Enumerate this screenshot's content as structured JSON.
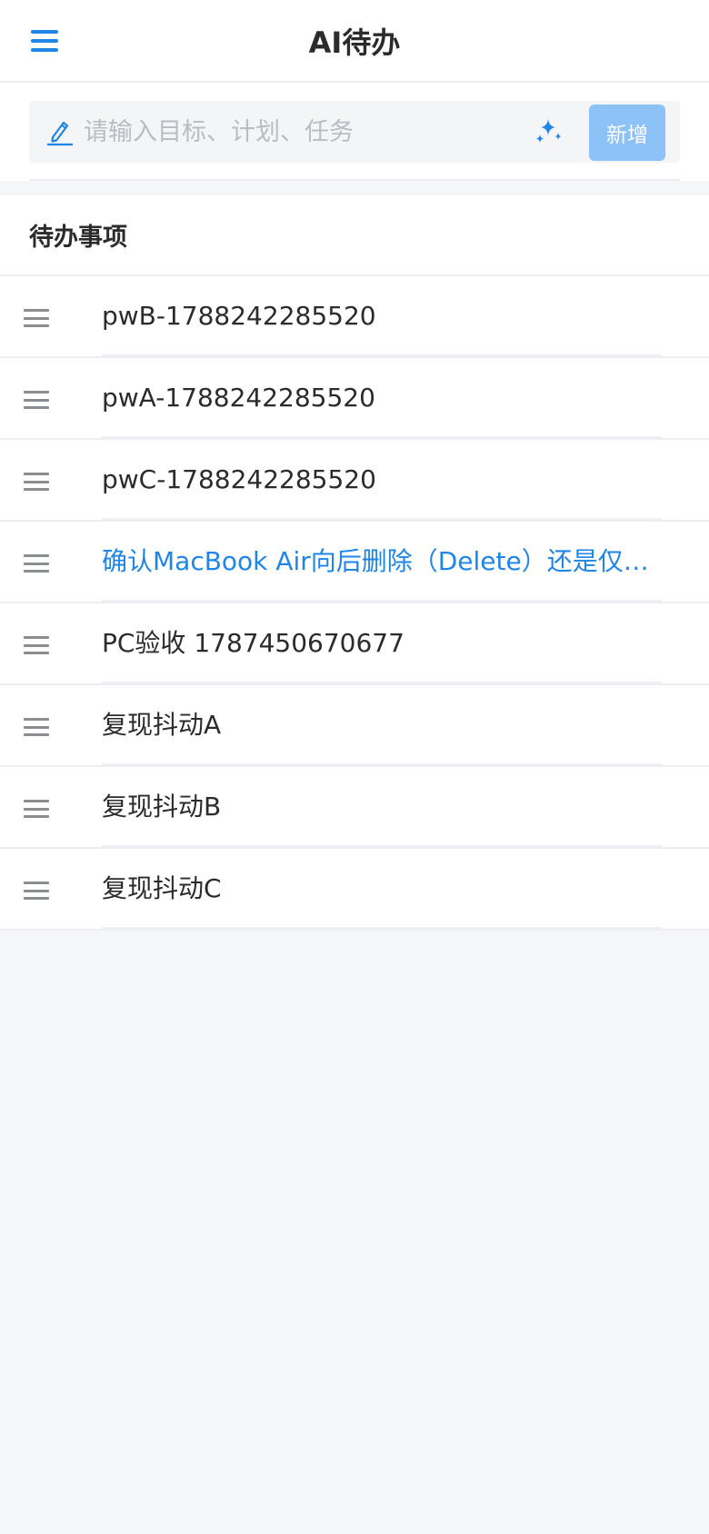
{
  "header": {
    "title": "AI待办"
  },
  "input": {
    "placeholder": "请输入目标、计划、任务",
    "value": "",
    "add_label": "新增"
  },
  "colors": {
    "accent": "#1f86e8",
    "add_button_bg": "#8cc2f8",
    "page_bg": "#f5f6f8"
  },
  "list": {
    "title": "待办事项",
    "items": [
      {
        "text": "pwB-1788242285520",
        "active": false
      },
      {
        "text": "pwA-1788242285520",
        "active": false
      },
      {
        "text": "pwC-1788242285520",
        "active": false
      },
      {
        "text": "确认MacBook Air向后删除（Delete）还是仅支持退格",
        "active": true
      },
      {
        "text": "PC验收 1787450670677",
        "active": false
      },
      {
        "text": "复现抖动A",
        "active": false
      },
      {
        "text": "复现抖动B",
        "active": false
      },
      {
        "text": "复现抖动C",
        "active": false
      }
    ]
  }
}
